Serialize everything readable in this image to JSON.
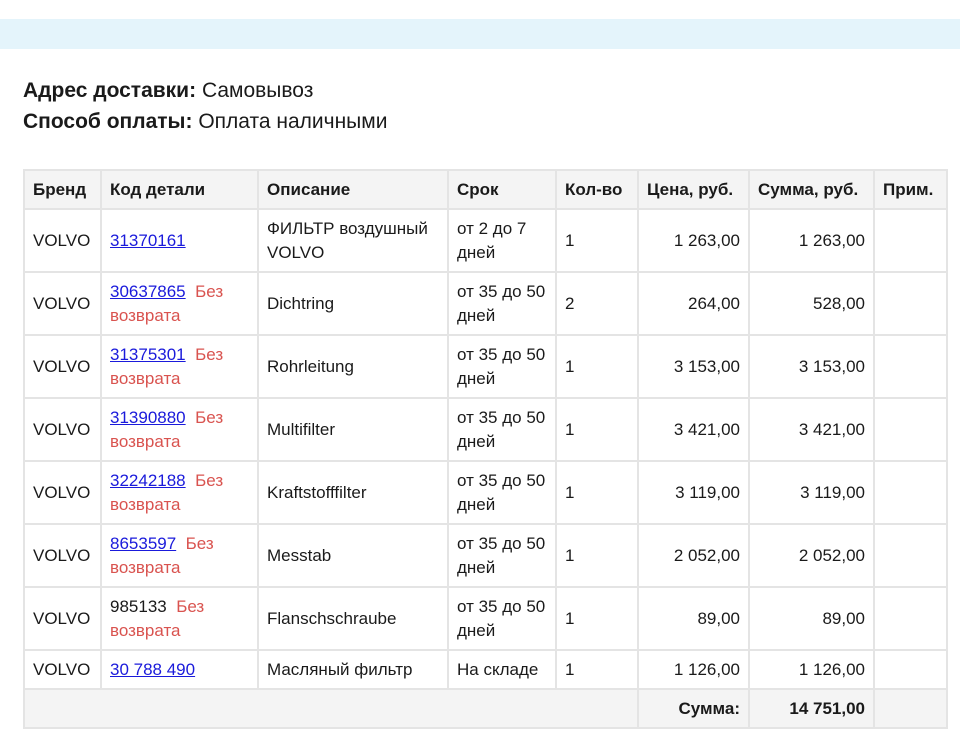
{
  "delivery": {
    "label": "Адрес доставки:",
    "value": "Самовывоз"
  },
  "payment": {
    "label": "Способ оплаты:",
    "value": "Оплата наличными"
  },
  "table": {
    "headers": [
      "Бренд",
      "Код детали",
      "Описание",
      "Срок",
      "Кол-во",
      "Цена, руб.",
      "Сумма, руб.",
      "Прим."
    ],
    "no_return_label": "Без возврата",
    "rows": [
      {
        "brand": "VOLVO",
        "code": "31370161",
        "code_link": true,
        "no_return": false,
        "description": "ФИЛЬТР воздушный VOLVO",
        "term": "от 2 до 7 дней",
        "qty": "1",
        "price": "1 263,00",
        "sum": "1 263,00",
        "note": ""
      },
      {
        "brand": "VOLVO",
        "code": "30637865",
        "code_link": true,
        "no_return": true,
        "description": "Dichtring",
        "term": "от 35 до 50 дней",
        "qty": "2",
        "price": "264,00",
        "sum": "528,00",
        "note": ""
      },
      {
        "brand": "VOLVO",
        "code": "31375301",
        "code_link": true,
        "no_return": true,
        "description": "Rohrleitung",
        "term": "от 35 до 50 дней",
        "qty": "1",
        "price": "3 153,00",
        "sum": "3 153,00",
        "note": ""
      },
      {
        "brand": "VOLVO",
        "code": "31390880",
        "code_link": true,
        "no_return": true,
        "description": "Multifilter",
        "term": "от 35 до 50 дней",
        "qty": "1",
        "price": "3 421,00",
        "sum": "3 421,00",
        "note": ""
      },
      {
        "brand": "VOLVO",
        "code": "32242188",
        "code_link": true,
        "no_return": true,
        "description": "Kraftstofffilter",
        "term": "от 35 до 50 дней",
        "qty": "1",
        "price": "3 119,00",
        "sum": "3 119,00",
        "note": ""
      },
      {
        "brand": "VOLVO",
        "code": "8653597",
        "code_link": true,
        "no_return": true,
        "description": "Messtab",
        "term": "от 35 до 50 дней",
        "qty": "1",
        "price": "2 052,00",
        "sum": "2 052,00",
        "note": ""
      },
      {
        "brand": "VOLVO",
        "code": "985133",
        "code_link": false,
        "no_return": true,
        "description": "Flanschschraube",
        "term": "от 35 до 50 дней",
        "qty": "1",
        "price": "89,00",
        "sum": "89,00",
        "note": ""
      },
      {
        "brand": "VOLVO",
        "code": "30 788 490",
        "code_link": true,
        "no_return": false,
        "description": "Масляный фильтр",
        "term": "На складе",
        "qty": "1",
        "price": "1 126,00",
        "sum": "1 126,00",
        "note": ""
      }
    ],
    "total_label": "Сумма:",
    "total_value": "14 751,00"
  }
}
